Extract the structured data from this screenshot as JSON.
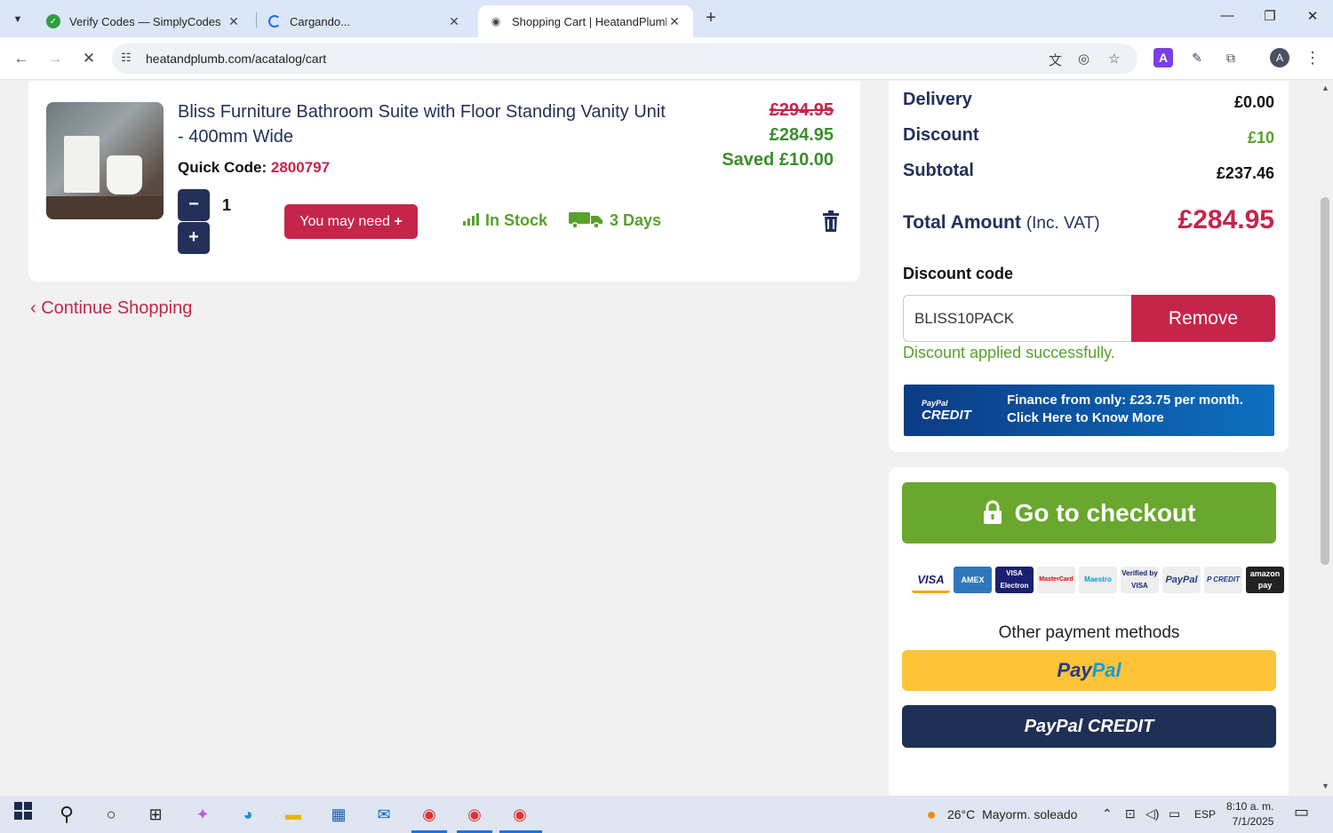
{
  "browser": {
    "tabs": [
      {
        "title": "Verify Codes — SimplyCodes",
        "active": false
      },
      {
        "title": "Cargando...",
        "active": false
      },
      {
        "title": "Shopping Cart | HeatandPlumb.",
        "active": true
      }
    ],
    "url": "heatandplumb.com/acatalog/cart",
    "profile_initial": "A"
  },
  "cart_item": {
    "name": "Bliss Furniture Bathroom Suite with Floor Standing Vanity Unit - 400mm Wide",
    "quick_code_label": "Quick Code:",
    "quick_code": "2800797",
    "price_old": "£294.95",
    "price_new": "£284.95",
    "saved": "Saved £10.00",
    "qty_minus": "−",
    "qty_plus": "+",
    "quantity": "1",
    "you_may_need": "You may need",
    "you_may_need_plus": "+",
    "stock": "In Stock",
    "delivery_time": "3 Days"
  },
  "continue_shopping": "Continue Shopping",
  "summary": {
    "delivery_label": "Delivery",
    "delivery_value": "£0.00",
    "discount_label": "Discount",
    "discount_value": "£10",
    "subtotal_label": "Subtotal",
    "subtotal_value": "£237.46",
    "total_label": "Total Amount",
    "total_suffix": "(Inc. VAT)",
    "total_value": "£284.95",
    "discount_code_label": "Discount code",
    "discount_code_value": "BLISS10PACK",
    "remove_label": "Remove",
    "discount_message": "Discount applied successfully.",
    "paypal_banner_brand_top": "PayPal",
    "paypal_banner_brand": "CREDIT",
    "paypal_banner_text": "Finance from only: £23.75 per month. Click Here to Know More"
  },
  "checkout": {
    "button_label": "Go to checkout",
    "payment_cards": [
      "VISA",
      "AMEX",
      "VISA Electron",
      "MasterCard",
      "Maestro",
      "Verified by VISA",
      "PayPal",
      "P CREDIT",
      "amazon pay"
    ],
    "other_methods_label": "Other payment methods",
    "paypal_p1": "Pay",
    "paypal_p2": "Pal",
    "paypal_credit_label": "PayPal CREDIT"
  },
  "taskbar": {
    "temperature": "26°C",
    "weather": "Mayorm. soleado",
    "language": "ESP",
    "time": "8:10 a. m.",
    "date": "7/1/2025"
  },
  "colors": {
    "brand_red": "#c6254a",
    "brand_navy": "#23305a",
    "success_green": "#5aa02c",
    "checkout_green": "#6aa72f"
  }
}
